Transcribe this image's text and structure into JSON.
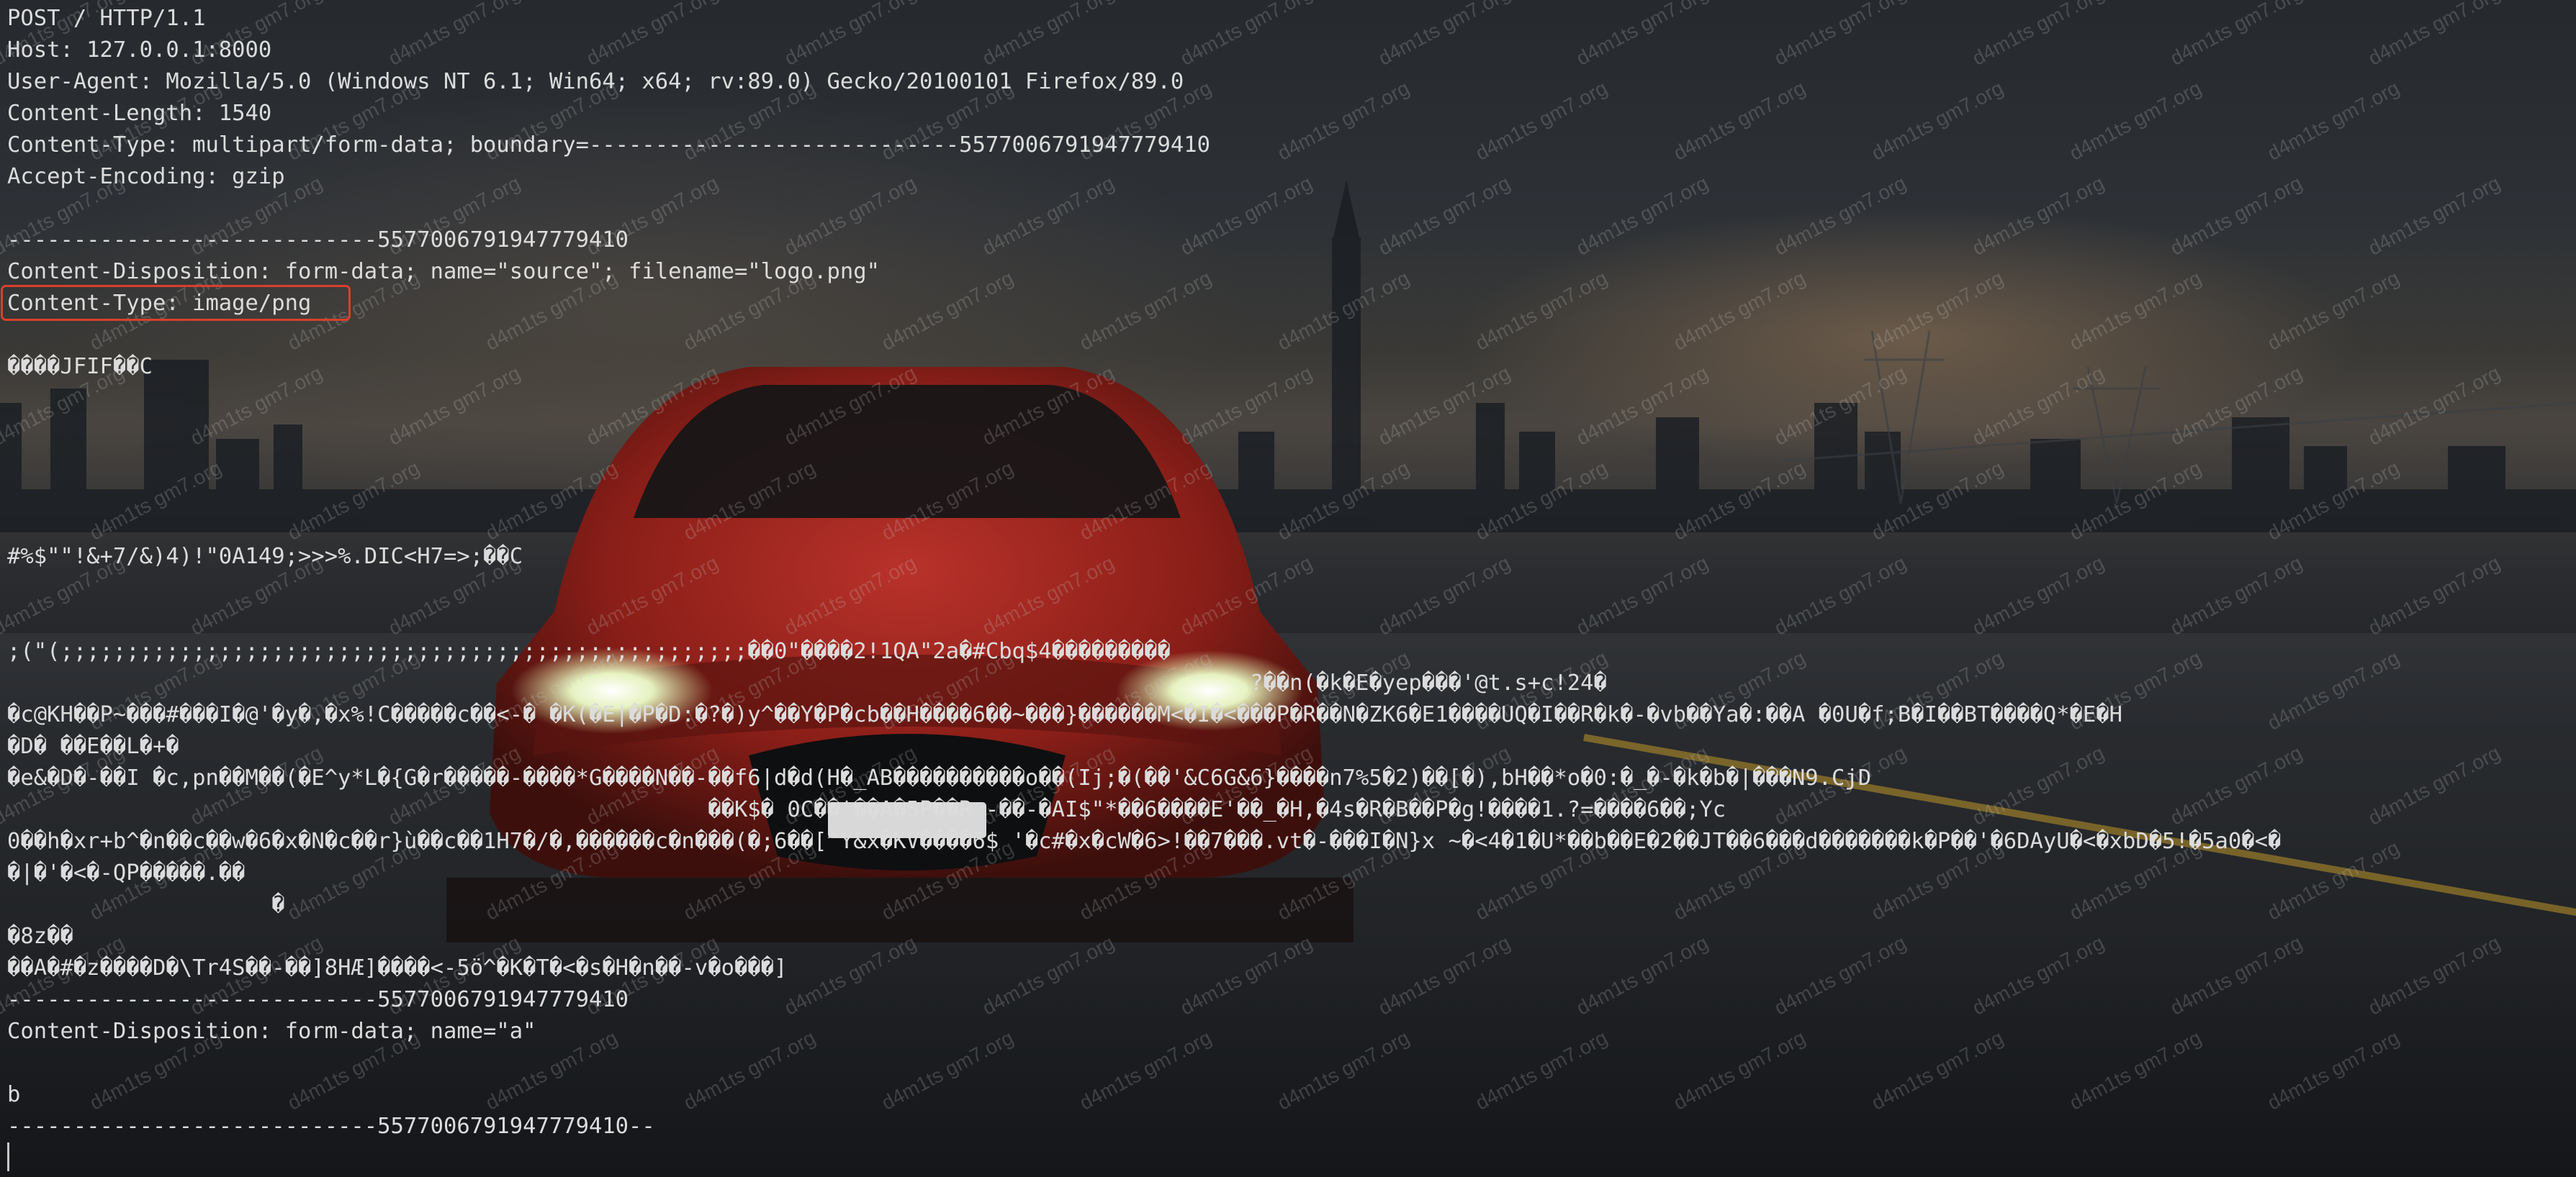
{
  "terminal": {
    "lines": [
      "POST / HTTP/1.1",
      "Host: 127.0.0.1:8000",
      "User-Agent: Mozilla/5.0 (Windows NT 6.1; Win64; x64; rv:89.0) Gecko/20100101 Firefox/89.0",
      "Content-Length: 1540",
      "Content-Type: multipart/form-data; boundary=----------------------------5577006791947779410",
      "Accept-Encoding: gzip",
      "",
      "----------------------------5577006791947779410",
      "Content-Disposition: form-data; name=\"source\"; filename=\"logo.png\"",
      "Content-Type: image/png",
      "",
      "����JFIF��C",
      "",
      "",
      "",
      "",
      "",
      "#%$\"\"!&+7/&)4)!\"0A149;>>>%.DIC<H7=>;��C",
      "",
      "",
      ";(\"(;;;;;;;;;;;;;;;;;;;;;;;;;;;;;;;;;;;;;;;;;;;;;;;;;;;;��0\"����2!1QA\"2a�#Cbq$4���������",
      "                                                                                              ?��n(�k�E�yep���'@t.s+c!24�",
      "�c@KH��P~���#���I�@'�y�,�x%!C�����c��<-� �K(�E|�P�D:�?�)y^��Y�P�cb��H����6��~���}������M<�I�<���P�R��N�ZK6�E1����UQ�I��R�k�-�vb��Ya�:��A �0U�f;B�I��BT����Q*�E�H",
      "�D� ��E��L�+�",
      "�e&�D�-��I �c,pn��M��(�E^y*L�{G�r�����-����*G����N��-��f6|d�d(H�_AB����������o��(Ij;�(��'&C6G&6}����n7%5�2)��[�),bH��*o�0:�_�-�k�b�|���N9.CjD",
      "                                                     ��K$� 0C��'��A�5P��R -��-�AI$\"*��6����E'��_�H,�4s�R�B��P�g!����1.?=����6��;Yc",
      "0��h�xr+b^�n��c��w�6�x�N�c��r}ù��c��1H7�/�,������c�n���(�;6��[^Y&x�KV����6$ '�c#�x�cW�6>!��7���.vt�-���I�N}x ~�<4�1�U*��b��E�2��JT��6���d�������k�P��'�6DAyU�<�xbD�5!�5a0�<�",
      "�|�'�<�-QP�����.��",
      "                    �",
      "�8z��",
      "��A�#�z����D�\\Tr4S��-��]8HÆ]����<-5ö^�K�T�<�s�H�n��-v�o���]",
      "----------------------------5577006791947779410",
      "Content-Disposition: form-data; name=\"a\"",
      "",
      "b",
      "----------------------------5577006791947779410--"
    ]
  },
  "highlight": {
    "color": "#d8402c"
  },
  "watermark": {
    "text": "d4m1ts gm7.org"
  },
  "icons": {
    "cursor": "text-cursor"
  }
}
